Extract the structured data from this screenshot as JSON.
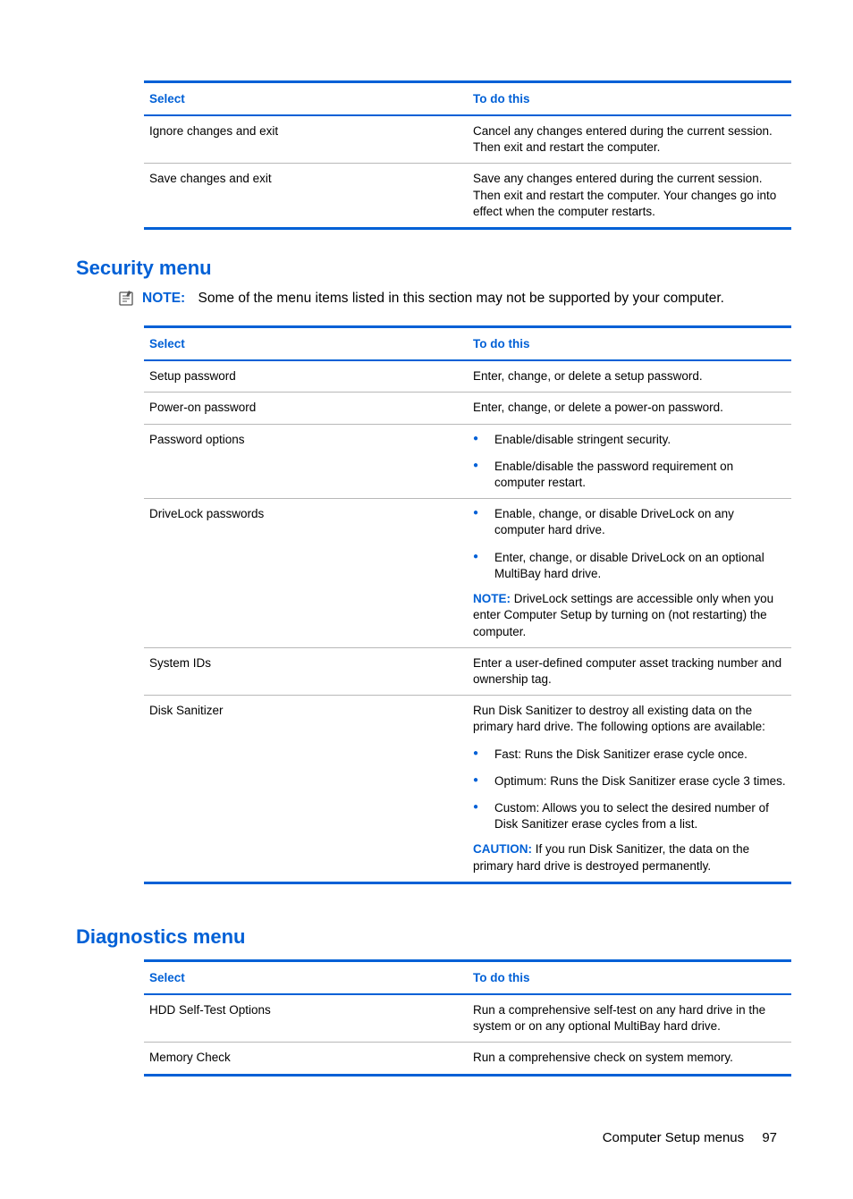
{
  "table1": {
    "head_select": "Select",
    "head_todo": "To do this",
    "rows": [
      {
        "select": "Ignore changes and exit",
        "todo": "Cancel any changes entered during the current session. Then exit and restart the computer."
      },
      {
        "select": "Save changes and exit",
        "todo": "Save any changes entered during the current session. Then exit and restart the computer. Your changes go into effect when the computer restarts."
      }
    ]
  },
  "security": {
    "title": "Security menu",
    "note_label": "NOTE:",
    "note_text": "Some of the menu items listed in this section may not be supported by your computer.",
    "head_select": "Select",
    "head_todo": "To do this",
    "rows": {
      "setup_password": {
        "select": "Setup password",
        "todo": "Enter, change, or delete a setup password."
      },
      "poweron_password": {
        "select": "Power-on password",
        "todo": "Enter, change, or delete a power-on password."
      },
      "password_options": {
        "select": "Password options",
        "bullets": [
          "Enable/disable stringent security.",
          "Enable/disable the password requirement on computer restart."
        ]
      },
      "drivelock": {
        "select": "DriveLock passwords",
        "bullets": [
          "Enable, change, or disable DriveLock on any computer hard drive.",
          "Enter, change, or disable DriveLock on an optional MultiBay hard drive."
        ],
        "note_label": "NOTE:",
        "note_text": "DriveLock settings are accessible only when you enter Computer Setup by turning on (not restarting) the computer."
      },
      "system_ids": {
        "select": "System IDs",
        "todo": "Enter a user-defined computer asset tracking number and ownership tag."
      },
      "disk_sanitizer": {
        "select": "Disk Sanitizer",
        "intro": "Run Disk Sanitizer to destroy all existing data on the primary hard drive. The following options are available:",
        "bullets": [
          "Fast: Runs the Disk Sanitizer erase cycle once.",
          "Optimum: Runs the Disk Sanitizer erase cycle 3 times.",
          "Custom: Allows you to select the desired number of Disk Sanitizer erase cycles from a list."
        ],
        "caution_label": "CAUTION:",
        "caution_text": "If you run Disk Sanitizer, the data on the primary hard drive is destroyed permanently."
      }
    }
  },
  "diagnostics": {
    "title": "Diagnostics menu",
    "head_select": "Select",
    "head_todo": "To do this",
    "rows": [
      {
        "select": "HDD Self-Test Options",
        "todo": "Run a comprehensive self-test on any hard drive in the system or on any optional MultiBay hard drive."
      },
      {
        "select": "Memory Check",
        "todo": "Run a comprehensive check on system memory."
      }
    ]
  },
  "footer": {
    "text": "Computer Setup menus",
    "page": "97"
  }
}
